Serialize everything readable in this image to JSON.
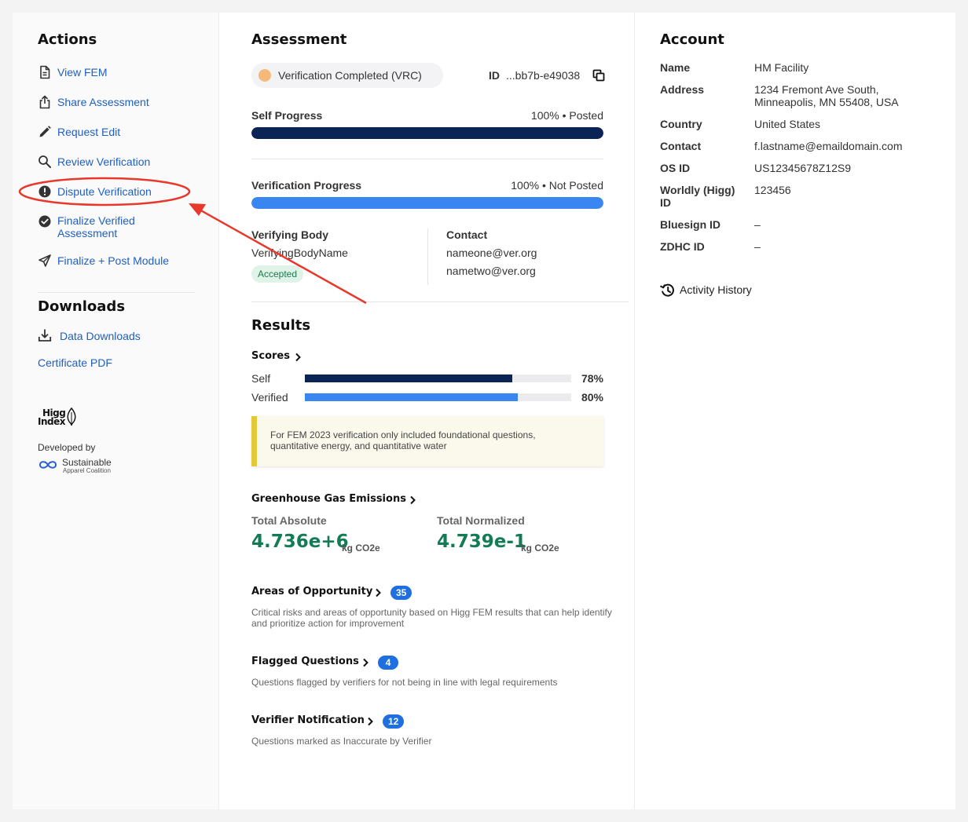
{
  "colors": {
    "link": "#1f5fbf",
    "navy": "#0b2456",
    "blue": "#3a86f0",
    "green": "#137c55",
    "annotation": "#e8372b",
    "status_dot": "#f5b97a"
  },
  "actions": {
    "heading": "Actions",
    "items": [
      {
        "label": "View FEM",
        "icon": "document-icon"
      },
      {
        "label": "Share Assessment",
        "icon": "share-icon"
      },
      {
        "label": "Request Edit",
        "icon": "pencil-icon"
      },
      {
        "label": "Review Verification",
        "icon": "search-icon"
      },
      {
        "label": "Dispute Verification",
        "icon": "exclamation-circle-icon"
      },
      {
        "label": "Finalize Verified Assessment",
        "icon": "check-circle-icon"
      },
      {
        "label": "Finalize + Post Module",
        "icon": "send-icon"
      }
    ]
  },
  "downloads": {
    "heading": "Downloads",
    "data_downloads": "Data Downloads",
    "certificate": "Certificate PDF"
  },
  "branding": {
    "logo_line1": "Higg",
    "logo_line2": "Index",
    "developed_by": "Developed by",
    "sac_line1": "Sustainable",
    "sac_line2": "Apparel Coalition"
  },
  "assessment": {
    "heading": "Assessment",
    "status": "Verification Completed (VRC)",
    "id_label": "ID",
    "id_value": "...bb7b-e49038",
    "self_progress": {
      "label": "Self Progress",
      "percent": 100,
      "status": "100% • Posted"
    },
    "verification_progress": {
      "label": "Verification Progress",
      "percent": 100,
      "status": "100% • Not Posted"
    },
    "verifying_body": {
      "label": "Verifying Body",
      "name": "VerifyingBodyName",
      "status": "Accepted"
    },
    "contact": {
      "label": "Contact",
      "emails": [
        "nameone@ver.org",
        "nametwo@ver.org"
      ]
    }
  },
  "results": {
    "heading": "Results",
    "scores": {
      "label": "Scores",
      "self": {
        "label": "Self",
        "percent": 78,
        "text": "78%"
      },
      "verified": {
        "label": "Verified",
        "percent": 80,
        "text": "80%"
      }
    },
    "note": "For FEM 2023 verification only included foundational questions, quantitative energy, and quantitative water",
    "ghg": {
      "label": "Greenhouse Gas Emissions",
      "absolute": {
        "label": "Total Absolute",
        "value": "4.736e+6",
        "unit": "kg CO2e"
      },
      "normalized": {
        "label": "Total Normalized",
        "value": "4.739e-1",
        "unit": "kg CO2e"
      }
    },
    "areas": {
      "label": "Areas of Opportunity",
      "count": "35",
      "desc": "Critical risks and areas of opportunity based on Higg FEM results that can help identify and prioritize action for improvement"
    },
    "flagged": {
      "label": "Flagged Questions",
      "count": "4",
      "desc": "Questions flagged by verifiers for not being in line with legal requirements"
    },
    "verifier": {
      "label": "Verifier Notification",
      "count": "12",
      "desc": "Questions marked as Inaccurate by Verifier"
    }
  },
  "account": {
    "heading": "Account",
    "rows": [
      {
        "label": "Name",
        "value": "HM Facility"
      },
      {
        "label": "Address",
        "value": "1234 Fremont Ave South, Minneapolis, MN 55408, USA"
      },
      {
        "label": "Country",
        "value": "United States"
      },
      {
        "label": "Contact",
        "value": "f.lastname@emaildomain.com"
      },
      {
        "label": "OS ID",
        "value": "US12345678Z12S9"
      },
      {
        "label": "Worldly (Higg) ID",
        "value": "123456"
      },
      {
        "label": "Bluesign ID",
        "value": "–"
      },
      {
        "label": "ZDHC ID",
        "value": "–"
      }
    ],
    "activity_history": "Activity History"
  }
}
